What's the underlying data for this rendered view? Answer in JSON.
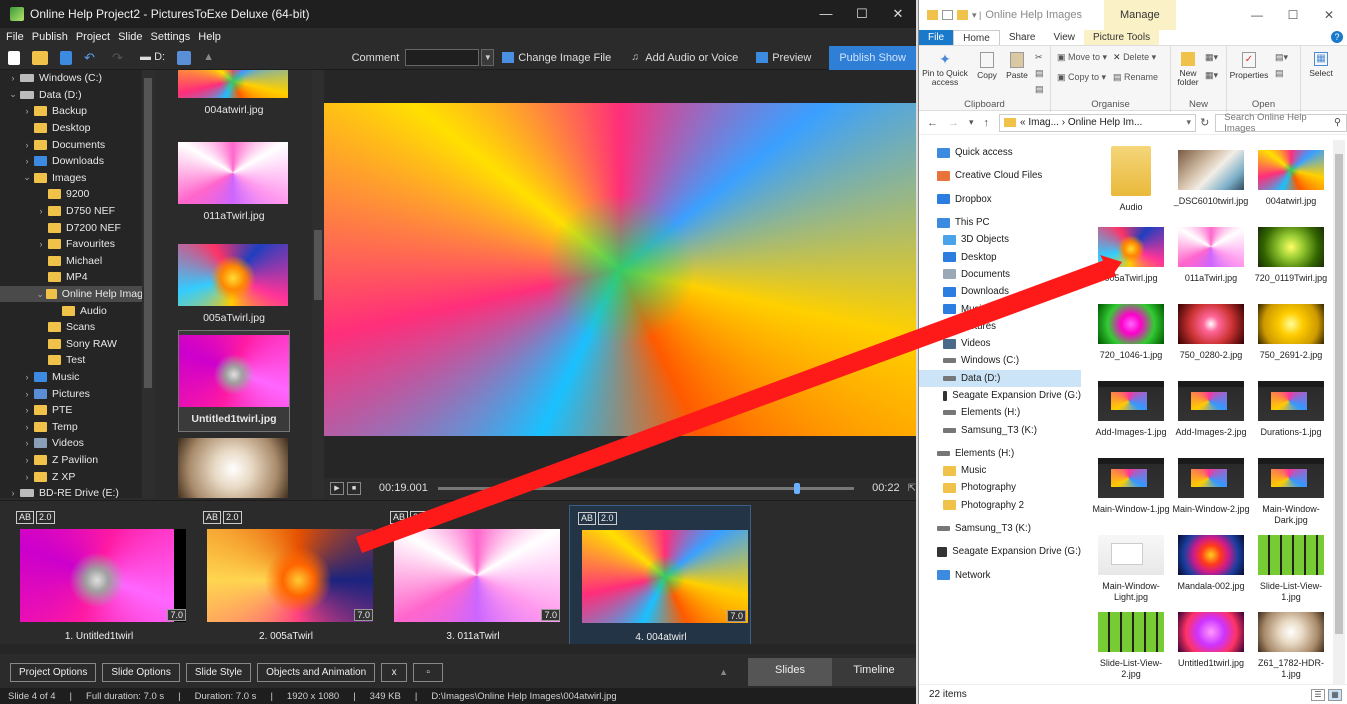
{
  "pte": {
    "title": "Online Help Project2 - PicturesToExe Deluxe (64-bit)",
    "menu": [
      "File",
      "Publish",
      "Project",
      "Slide",
      "Settings",
      "Help"
    ],
    "toolbar": {
      "comment_label": "Comment",
      "change_image": "Change Image File",
      "add_audio": "Add Audio or Voice",
      "preview": "Preview",
      "publish": "Publish Show",
      "drive_label": "D:"
    },
    "tree": [
      {
        "label": "Windows (C:)",
        "type": "drive",
        "level": 0,
        "chev": ">"
      },
      {
        "label": "Data (D:)",
        "type": "drive",
        "level": 0,
        "chev": "v"
      },
      {
        "label": "Backup",
        "type": "folder",
        "level": 1,
        "chev": ">"
      },
      {
        "label": "Desktop",
        "type": "folder",
        "level": 1,
        "chev": ""
      },
      {
        "label": "Documents",
        "type": "folder",
        "level": 1,
        "chev": ">"
      },
      {
        "label": "Downloads",
        "type": "download",
        "level": 1,
        "chev": ">"
      },
      {
        "label": "Images",
        "type": "folder",
        "level": 1,
        "chev": "v"
      },
      {
        "label": "9200",
        "type": "folder",
        "level": 2,
        "chev": ""
      },
      {
        "label": "D750 NEF",
        "type": "folder",
        "level": 2,
        "chev": ">"
      },
      {
        "label": "D7200 NEF",
        "type": "folder",
        "level": 2,
        "chev": ""
      },
      {
        "label": "Favourites",
        "type": "folder",
        "level": 2,
        "chev": ">"
      },
      {
        "label": "Michael",
        "type": "folder",
        "level": 2,
        "chev": ""
      },
      {
        "label": "MP4",
        "type": "folder",
        "level": 2,
        "chev": ""
      },
      {
        "label": "Online Help Images",
        "type": "folder",
        "level": 2,
        "chev": "v",
        "selected": true
      },
      {
        "label": "Audio",
        "type": "folder",
        "level": 3,
        "chev": ""
      },
      {
        "label": "Scans",
        "type": "folder",
        "level": 2,
        "chev": ""
      },
      {
        "label": "Sony RAW",
        "type": "folder",
        "level": 2,
        "chev": ""
      },
      {
        "label": "Test",
        "type": "folder",
        "level": 2,
        "chev": ""
      },
      {
        "label": "Music",
        "type": "music",
        "level": 1,
        "chev": ">"
      },
      {
        "label": "Pictures",
        "type": "pictures",
        "level": 1,
        "chev": ">"
      },
      {
        "label": "PTE",
        "type": "folder",
        "level": 1,
        "chev": ">"
      },
      {
        "label": "Temp",
        "type": "folder",
        "level": 1,
        "chev": ">"
      },
      {
        "label": "Videos",
        "type": "videos",
        "level": 1,
        "chev": ">"
      },
      {
        "label": "Z Pavilion",
        "type": "folder",
        "level": 1,
        "chev": ">"
      },
      {
        "label": "Z XP",
        "type": "folder",
        "level": 1,
        "chev": ">"
      },
      {
        "label": "BD-RE Drive (E:)",
        "type": "drive",
        "level": 0,
        "chev": ">"
      }
    ],
    "thumbnails": [
      {
        "name": "004atwirl.jpg"
      },
      {
        "name": "011aTwirl.jpg"
      },
      {
        "name": "005aTwirl.jpg"
      },
      {
        "name": "Untitled1twirl.jpg"
      },
      {
        "name": ""
      }
    ],
    "player": {
      "current": "00:19.001",
      "end": "00:22",
      "progress": 0.86
    },
    "slides": [
      {
        "ab": "AB",
        "transition": "2.0",
        "duration": "7.0",
        "name": "1. Untitled1twirl"
      },
      {
        "ab": "AB",
        "transition": "2.0",
        "duration": "7.0",
        "name": "2. 005aTwirl"
      },
      {
        "ab": "AB",
        "transition": "2.0",
        "duration": "7.0",
        "name": "3. 011aTwirl"
      },
      {
        "ab": "AB",
        "transition": "2.0",
        "duration": "7.0",
        "name": "4. 004atwirl"
      }
    ],
    "bottom_buttons": {
      "project_options": "Project Options",
      "slide_options": "Slide Options",
      "slide_style": "Slide Style",
      "objects_animation": "Objects and Animation",
      "x": "x"
    },
    "tabs": {
      "slides": "Slides",
      "timeline": "Timeline"
    },
    "status": {
      "slide": "Slide 4 of 4",
      "full_duration": "Full duration: 7.0 s",
      "duration": "Duration: 7.0 s",
      "resolution": "1920 x 1080",
      "size": "349 KB",
      "path": "D:\\Images\\Online Help Images\\004atwirl.jpg"
    }
  },
  "explorer": {
    "title": "Online Help Images",
    "manage": "Manage",
    "ribbon_tabs": {
      "file": "File",
      "home": "Home",
      "share": "Share",
      "view": "View",
      "picture_tools": "Picture Tools"
    },
    "ribbon": {
      "pin": "Pin to Quick access",
      "copy": "Copy",
      "paste": "Paste",
      "clipboard": "Clipboard",
      "move_to": "Move to",
      "copy_to": "Copy to",
      "delete": "Delete",
      "rename": "Rename",
      "organise": "Organise",
      "new_folder": "New folder",
      "new": "New",
      "properties": "Properties",
      "open": "Open",
      "select": "Select"
    },
    "address": "« Imag... › Online Help Im...",
    "search_placeholder": "Search Online Help Images",
    "nav": [
      {
        "label": "Quick access",
        "icon": "star",
        "group_gap": false
      },
      {
        "label": "Creative Cloud Files",
        "icon": "cc",
        "group_gap": true
      },
      {
        "label": "Dropbox",
        "icon": "dropbox",
        "group_gap": true
      },
      {
        "label": "This PC",
        "icon": "pc",
        "group_gap": true
      },
      {
        "label": "3D Objects",
        "icon": "obj3d",
        "group_gap": false
      },
      {
        "label": "Desktop",
        "icon": "desktop",
        "group_gap": false
      },
      {
        "label": "Documents",
        "icon": "docs",
        "group_gap": false
      },
      {
        "label": "Downloads",
        "icon": "down",
        "group_gap": false
      },
      {
        "label": "Music",
        "icon": "music",
        "group_gap": false
      },
      {
        "label": "Pictures",
        "icon": "pics",
        "group_gap": false
      },
      {
        "label": "Videos",
        "icon": "video",
        "group_gap": false
      },
      {
        "label": "Windows (C:)",
        "icon": "drive",
        "group_gap": false
      },
      {
        "label": "Data (D:)",
        "icon": "drive",
        "group_gap": false,
        "selected": true
      },
      {
        "label": "Seagate Expansion Drive (G:)",
        "icon": "hdd",
        "group_gap": false
      },
      {
        "label": "Elements (H:)",
        "icon": "drive",
        "group_gap": false
      },
      {
        "label": "Samsung_T3 (K:)",
        "icon": "drive",
        "group_gap": false
      },
      {
        "label": "Elements (H:)",
        "icon": "drive",
        "group_gap": true
      },
      {
        "label": "Music",
        "icon": "folder",
        "group_gap": false
      },
      {
        "label": "Photography",
        "icon": "folder",
        "group_gap": false
      },
      {
        "label": "Photography 2",
        "icon": "folder",
        "group_gap": false
      },
      {
        "label": "Samsung_T3 (K:)",
        "icon": "drive",
        "group_gap": true
      },
      {
        "label": "Seagate Expansion Drive (G:)",
        "icon": "hdd",
        "group_gap": true
      },
      {
        "label": "Network",
        "icon": "net",
        "group_gap": true
      }
    ],
    "files": [
      {
        "name": "Audio",
        "kind": "folder"
      },
      {
        "name": "_DSC6010twirl.jpg",
        "kind": "tw-k"
      },
      {
        "name": "004atwirl.jpg",
        "kind": "tw-c"
      },
      {
        "name": "005aTwirl.jpg",
        "kind": "tw-a"
      },
      {
        "name": "011aTwirl.jpg",
        "kind": "tw-b"
      },
      {
        "name": "720_0119Twirl.jpg",
        "kind": "tw-g"
      },
      {
        "name": "720_1046-1.jpg",
        "kind": "tw-h"
      },
      {
        "name": "750_0280-2.jpg",
        "kind": "tw-i"
      },
      {
        "name": "750_2691-2.jpg",
        "kind": "tw-j"
      },
      {
        "name": "Add-Images-1.jpg",
        "kind": "shot-dark"
      },
      {
        "name": "Add-Images-2.jpg",
        "kind": "shot-dark"
      },
      {
        "name": "Durations-1.jpg",
        "kind": "shot-dark"
      },
      {
        "name": "Main-Window-1.jpg",
        "kind": "shot-dark"
      },
      {
        "name": "Main-Window-2.jpg",
        "kind": "shot-dark"
      },
      {
        "name": "Main-Window-Dark.jpg",
        "kind": "shot-dark"
      },
      {
        "name": "Main-Window-Light.jpg",
        "kind": "shot-light"
      },
      {
        "name": "Mandala-002.jpg",
        "kind": "mandala"
      },
      {
        "name": "Slide-List-View-1.jpg",
        "kind": "shot-grid"
      },
      {
        "name": "Slide-List-View-2.jpg",
        "kind": "shot-grid"
      },
      {
        "name": "Untitled1twirl.jpg",
        "kind": "tw-l"
      },
      {
        "name": "Z61_1782-HDR-1.jpg",
        "kind": "tw-m"
      }
    ],
    "status": "22 items"
  }
}
